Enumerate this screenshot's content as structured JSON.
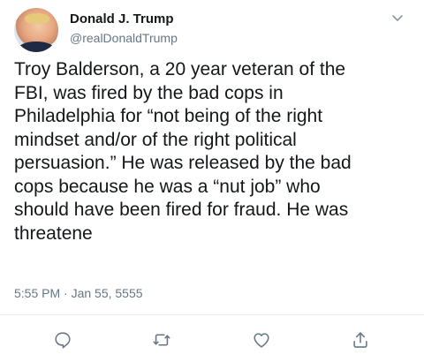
{
  "tweet": {
    "author_name": "Donald J. Trump",
    "author_handle": "@realDonaldTrump",
    "text": "Troy Balderson, a 20 year veteran of the\nFBI, was fired by the bad cops in\nPhiladelphia for “not being of the right\nmindset and/or of the right political\npersuasion.” He was released by the bad\ncops because he was a “nut job” who\nshould have been fired for fraud. He was\nthreatene",
    "timestamp": "5:55 PM · Jan 55, 5555"
  },
  "icons": {
    "menu": "chevron-down-icon",
    "reply": "reply-icon",
    "retweet": "retweet-icon",
    "like": "heart-icon",
    "share": "share-icon"
  },
  "colors": {
    "text": "#14171a",
    "secondary": "#657786",
    "divider": "#e6ecf0"
  }
}
